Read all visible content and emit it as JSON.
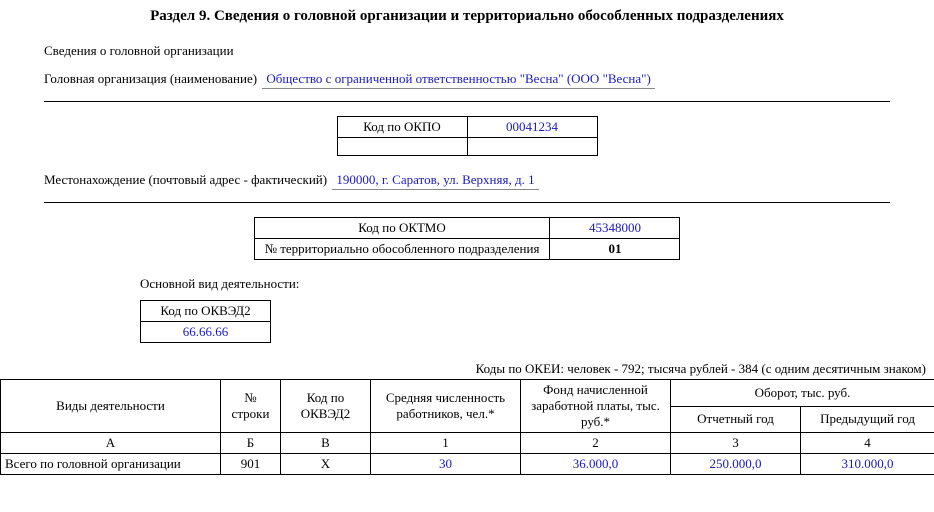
{
  "title": "Раздел 9. Сведения о головной организации и территориально обособленных подразделениях",
  "subsection": "Сведения о головной организации",
  "org": {
    "label": "Головная организация (наименование)",
    "value": "Общество с ограниченной ответственностью \"Весна\" (ООО \"Весна\")"
  },
  "okpo": {
    "label": "Код по ОКПО",
    "value": "00041234"
  },
  "address": {
    "label": "Местонахождение (почтовый адрес - фактический)",
    "value": "190000, г. Саратов, ул. Верхняя, д. 1"
  },
  "oktmo": {
    "label": "Код по ОКТМО",
    "value": "45348000"
  },
  "podr": {
    "label": "№ территориально обособленного подразделения",
    "value": "01"
  },
  "activity": {
    "heading": "Основной вид деятельности:",
    "okved_label": "Код по ОКВЭД2",
    "okved_code": "66.66.66"
  },
  "okei_line": "Коды по ОКЕИ: человек - 792; тысяча рублей - 384 (с одним десятичным знаком)",
  "table": {
    "headers": {
      "vid": "Виды деятельности",
      "nstr": "№ строки",
      "kod": "Код по ОКВЭД2",
      "sredn": "Средняя численность работников, чел.*",
      "fond": "Фонд начисленной заработной платы, тыс. руб.*",
      "oborot": "Оборот, тыс. руб.",
      "otchet": "Отчетный год",
      "pred": "Предыдущий год"
    },
    "letters": {
      "a": "А",
      "b": "Б",
      "v": "В",
      "c1": "1",
      "c2": "2",
      "c3": "3",
      "c4": "4"
    },
    "row": {
      "name": "Всего по головной организации",
      "nstr": "901",
      "kod": "Х",
      "sredn": "30",
      "fond": "36.000,0",
      "otchet": "250.000,0",
      "pred": "310.000,0"
    }
  }
}
